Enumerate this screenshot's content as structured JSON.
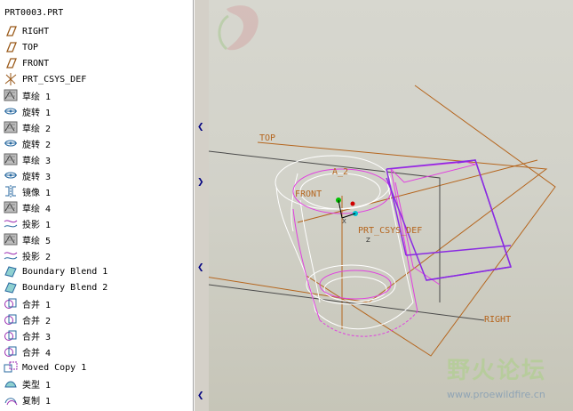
{
  "model_tree": {
    "root": "PRT0003.PRT",
    "items": [
      {
        "label": "RIGHT",
        "icon": "datum-plane-icon"
      },
      {
        "label": "TOP",
        "icon": "datum-plane-icon"
      },
      {
        "label": "FRONT",
        "icon": "datum-plane-icon"
      },
      {
        "label": "PRT_CSYS_DEF",
        "icon": "coordinate-system-icon"
      },
      {
        "label": "草绘 1",
        "icon": "sketch-icon"
      },
      {
        "label": "旋转 1",
        "icon": "revolve-icon"
      },
      {
        "label": "草绘 2",
        "icon": "sketch-icon"
      },
      {
        "label": "旋转 2",
        "icon": "revolve-icon"
      },
      {
        "label": "草绘 3",
        "icon": "sketch-icon"
      },
      {
        "label": "旋转 3",
        "icon": "revolve-icon"
      },
      {
        "label": "镜像 1",
        "icon": "mirror-icon"
      },
      {
        "label": "草绘 4",
        "icon": "sketch-icon"
      },
      {
        "label": "投影 1",
        "icon": "projection-icon"
      },
      {
        "label": "草绘 5",
        "icon": "sketch-icon"
      },
      {
        "label": "投影 2",
        "icon": "projection-icon"
      },
      {
        "label": "Boundary Blend 1",
        "icon": "boundary-blend-icon"
      },
      {
        "label": "Boundary Blend 2",
        "icon": "boundary-blend-icon"
      },
      {
        "label": "合并 1",
        "icon": "merge-icon"
      },
      {
        "label": "合并 2",
        "icon": "merge-icon"
      },
      {
        "label": "合并 3",
        "icon": "merge-icon"
      },
      {
        "label": "合并 4",
        "icon": "merge-icon"
      },
      {
        "label": "Moved Copy 1",
        "icon": "moved-copy-icon"
      },
      {
        "label": "类型 1",
        "icon": "type-icon"
      },
      {
        "label": "复制 1",
        "icon": "copy-icon"
      }
    ]
  },
  "viewport": {
    "labels": {
      "top": "TOP",
      "right": "RIGHT",
      "front": "FRONT",
      "csys": "PRT_CSYS_DEF",
      "axis": "A_2",
      "x": "X",
      "z": "Z"
    },
    "colors": {
      "datum": "#b5651d",
      "surface_white": "#ffffff",
      "surface_magenta": "#e040e0",
      "surface_purple": "#8a2be2",
      "edge_dark": "#3a3a3a"
    }
  },
  "watermark": {
    "title": "野火论坛",
    "url": "www.proewildfire.cn"
  }
}
